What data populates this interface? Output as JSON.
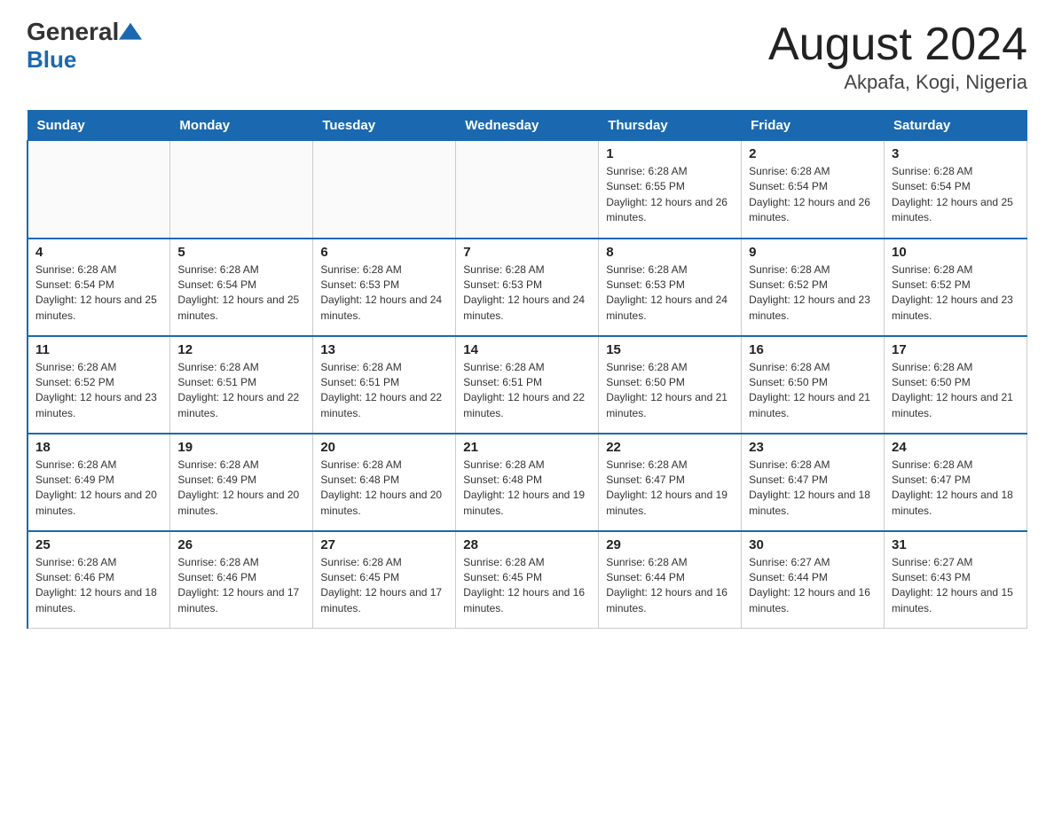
{
  "header": {
    "logo_general": "General",
    "logo_blue": "Blue",
    "month_title": "August 2024",
    "location": "Akpafa, Kogi, Nigeria"
  },
  "calendar": {
    "days_of_week": [
      "Sunday",
      "Monday",
      "Tuesday",
      "Wednesday",
      "Thursday",
      "Friday",
      "Saturday"
    ],
    "weeks": [
      [
        {
          "day": "",
          "info": ""
        },
        {
          "day": "",
          "info": ""
        },
        {
          "day": "",
          "info": ""
        },
        {
          "day": "",
          "info": ""
        },
        {
          "day": "1",
          "info": "Sunrise: 6:28 AM\nSunset: 6:55 PM\nDaylight: 12 hours and 26 minutes."
        },
        {
          "day": "2",
          "info": "Sunrise: 6:28 AM\nSunset: 6:54 PM\nDaylight: 12 hours and 26 minutes."
        },
        {
          "day": "3",
          "info": "Sunrise: 6:28 AM\nSunset: 6:54 PM\nDaylight: 12 hours and 25 minutes."
        }
      ],
      [
        {
          "day": "4",
          "info": "Sunrise: 6:28 AM\nSunset: 6:54 PM\nDaylight: 12 hours and 25 minutes."
        },
        {
          "day": "5",
          "info": "Sunrise: 6:28 AM\nSunset: 6:54 PM\nDaylight: 12 hours and 25 minutes."
        },
        {
          "day": "6",
          "info": "Sunrise: 6:28 AM\nSunset: 6:53 PM\nDaylight: 12 hours and 24 minutes."
        },
        {
          "day": "7",
          "info": "Sunrise: 6:28 AM\nSunset: 6:53 PM\nDaylight: 12 hours and 24 minutes."
        },
        {
          "day": "8",
          "info": "Sunrise: 6:28 AM\nSunset: 6:53 PM\nDaylight: 12 hours and 24 minutes."
        },
        {
          "day": "9",
          "info": "Sunrise: 6:28 AM\nSunset: 6:52 PM\nDaylight: 12 hours and 23 minutes."
        },
        {
          "day": "10",
          "info": "Sunrise: 6:28 AM\nSunset: 6:52 PM\nDaylight: 12 hours and 23 minutes."
        }
      ],
      [
        {
          "day": "11",
          "info": "Sunrise: 6:28 AM\nSunset: 6:52 PM\nDaylight: 12 hours and 23 minutes."
        },
        {
          "day": "12",
          "info": "Sunrise: 6:28 AM\nSunset: 6:51 PM\nDaylight: 12 hours and 22 minutes."
        },
        {
          "day": "13",
          "info": "Sunrise: 6:28 AM\nSunset: 6:51 PM\nDaylight: 12 hours and 22 minutes."
        },
        {
          "day": "14",
          "info": "Sunrise: 6:28 AM\nSunset: 6:51 PM\nDaylight: 12 hours and 22 minutes."
        },
        {
          "day": "15",
          "info": "Sunrise: 6:28 AM\nSunset: 6:50 PM\nDaylight: 12 hours and 21 minutes."
        },
        {
          "day": "16",
          "info": "Sunrise: 6:28 AM\nSunset: 6:50 PM\nDaylight: 12 hours and 21 minutes."
        },
        {
          "day": "17",
          "info": "Sunrise: 6:28 AM\nSunset: 6:50 PM\nDaylight: 12 hours and 21 minutes."
        }
      ],
      [
        {
          "day": "18",
          "info": "Sunrise: 6:28 AM\nSunset: 6:49 PM\nDaylight: 12 hours and 20 minutes."
        },
        {
          "day": "19",
          "info": "Sunrise: 6:28 AM\nSunset: 6:49 PM\nDaylight: 12 hours and 20 minutes."
        },
        {
          "day": "20",
          "info": "Sunrise: 6:28 AM\nSunset: 6:48 PM\nDaylight: 12 hours and 20 minutes."
        },
        {
          "day": "21",
          "info": "Sunrise: 6:28 AM\nSunset: 6:48 PM\nDaylight: 12 hours and 19 minutes."
        },
        {
          "day": "22",
          "info": "Sunrise: 6:28 AM\nSunset: 6:47 PM\nDaylight: 12 hours and 19 minutes."
        },
        {
          "day": "23",
          "info": "Sunrise: 6:28 AM\nSunset: 6:47 PM\nDaylight: 12 hours and 18 minutes."
        },
        {
          "day": "24",
          "info": "Sunrise: 6:28 AM\nSunset: 6:47 PM\nDaylight: 12 hours and 18 minutes."
        }
      ],
      [
        {
          "day": "25",
          "info": "Sunrise: 6:28 AM\nSunset: 6:46 PM\nDaylight: 12 hours and 18 minutes."
        },
        {
          "day": "26",
          "info": "Sunrise: 6:28 AM\nSunset: 6:46 PM\nDaylight: 12 hours and 17 minutes."
        },
        {
          "day": "27",
          "info": "Sunrise: 6:28 AM\nSunset: 6:45 PM\nDaylight: 12 hours and 17 minutes."
        },
        {
          "day": "28",
          "info": "Sunrise: 6:28 AM\nSunset: 6:45 PM\nDaylight: 12 hours and 16 minutes."
        },
        {
          "day": "29",
          "info": "Sunrise: 6:28 AM\nSunset: 6:44 PM\nDaylight: 12 hours and 16 minutes."
        },
        {
          "day": "30",
          "info": "Sunrise: 6:27 AM\nSunset: 6:44 PM\nDaylight: 12 hours and 16 minutes."
        },
        {
          "day": "31",
          "info": "Sunrise: 6:27 AM\nSunset: 6:43 PM\nDaylight: 12 hours and 15 minutes."
        }
      ]
    ]
  }
}
